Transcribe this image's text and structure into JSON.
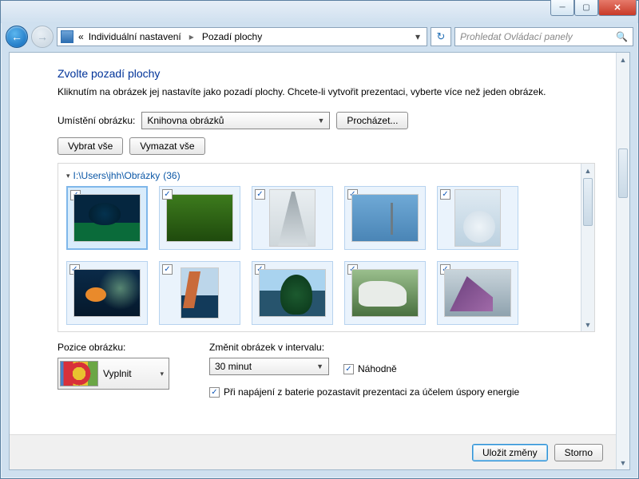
{
  "window": {
    "min_icon": "─",
    "max_icon": "▢",
    "close_icon": "✕"
  },
  "nav": {
    "back_icon": "←",
    "fwd_icon": "→",
    "crumb_prefix": "«",
    "crumb1": "Individuální nastavení",
    "crumb2": "Pozadí plochy",
    "sep": "▸",
    "drop_icon": "▾",
    "refresh_icon": "↻",
    "search_placeholder": "Prohledat Ovládací panely",
    "search_icon": "🔍"
  },
  "page": {
    "title": "Zvolte pozadí plochy",
    "subtitle": "Kliknutím na obrázek jej nastavíte jako pozadí plochy. Chcete-li vytvořit prezentaci, vyberte více než jeden obrázek."
  },
  "location": {
    "label": "Umístění obrázku:",
    "value": "Knihovna obrázků",
    "browse": "Procházet..."
  },
  "select_buttons": {
    "select_all": "Vybrat vše",
    "clear_all": "Vymazat vše"
  },
  "group": {
    "triangle": "▾",
    "path": "I:\\Users\\jhh\\Obrázky",
    "count": "(36)"
  },
  "thumbs": [
    {
      "checked": true,
      "selected": true
    },
    {
      "checked": true,
      "selected": false
    },
    {
      "checked": true,
      "selected": false
    },
    {
      "checked": true,
      "selected": false
    },
    {
      "checked": true,
      "selected": false
    },
    {
      "checked": true,
      "selected": false
    },
    {
      "checked": true,
      "selected": false
    },
    {
      "checked": true,
      "selected": false
    },
    {
      "checked": true,
      "selected": false
    },
    {
      "checked": true,
      "selected": false
    }
  ],
  "position": {
    "label": "Pozice obrázku:",
    "value": "Vyplnit",
    "drop": "▾"
  },
  "interval": {
    "label": "Změnit obrázek v intervalu:",
    "value": "30 minut",
    "drop": "▾",
    "shuffle": "Náhodně",
    "battery": "Při napájení z baterie pozastavit prezentaci za účelem úspory energie"
  },
  "footer": {
    "save": "Uložit změny",
    "cancel": "Storno"
  },
  "check_glyph": "✓"
}
